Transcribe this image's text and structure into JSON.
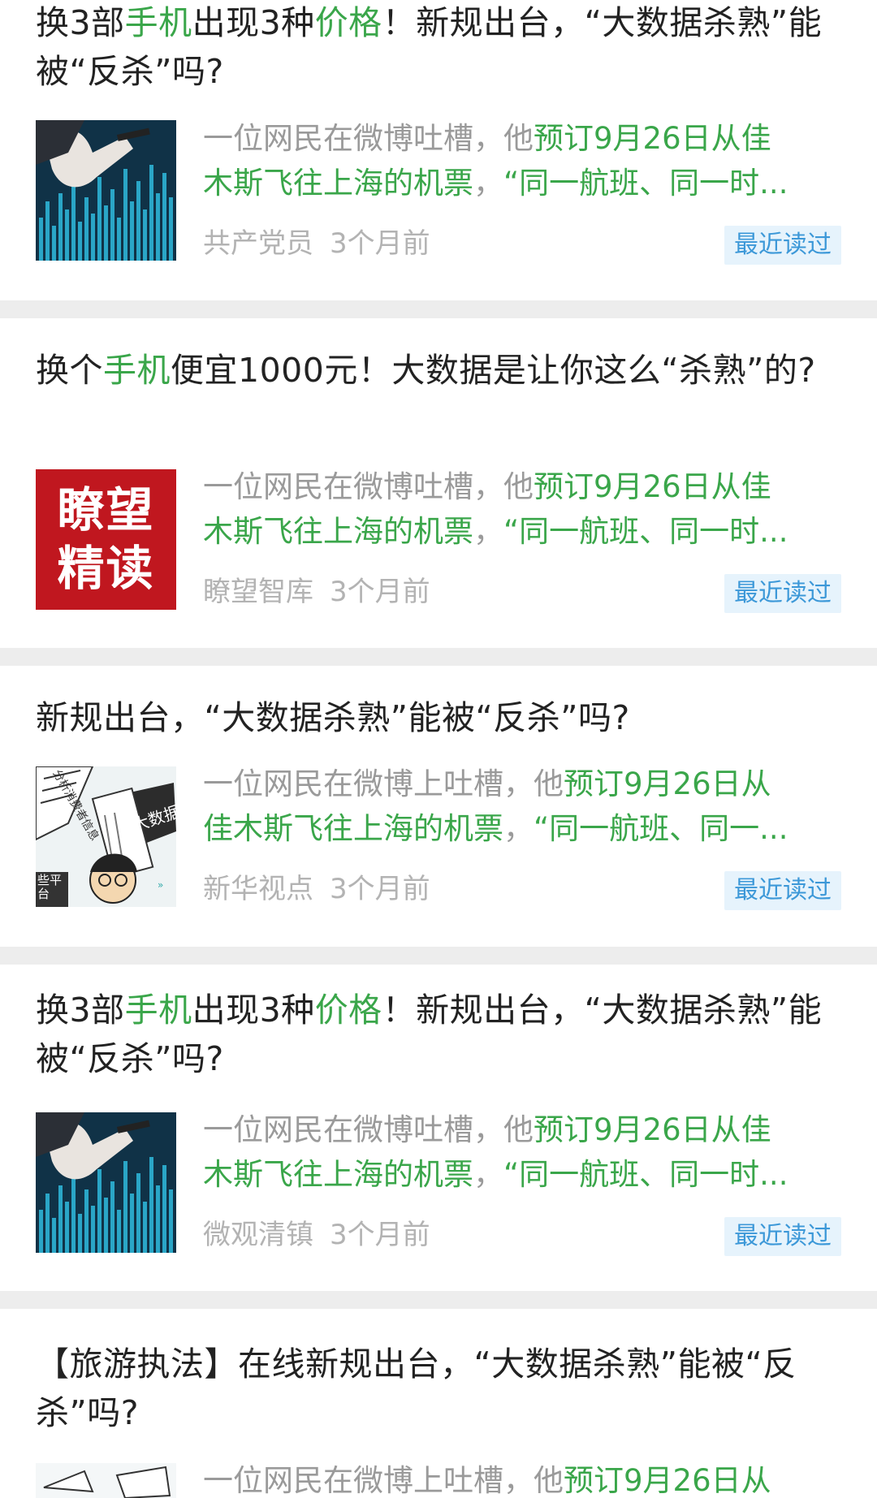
{
  "feed": {
    "cards": [
      {
        "title_parts": [
          "换3部",
          "手机",
          "出现3种",
          "价格",
          "！新规出台，“大数据杀熟”能被“反杀”吗?"
        ],
        "summary_line1_gray": "一位网民在微博吐槽，他",
        "summary_line1_green": "预订9月26日从佳",
        "summary_line2_green": "木斯飞往上海的机票",
        "summary_line2_gray": "，",
        "summary_line2_green2": "“同一航班、同一时...",
        "source": "共产党员",
        "time": "3个月前",
        "badge": "最近读过"
      },
      {
        "title_parts": [
          "换个",
          "手机",
          "便宜1000元！大数据是让你这么“杀熟”的?"
        ],
        "thumb_text": "瞭望精读",
        "summary_line1_gray": "一位网民在微博吐槽，他",
        "summary_line1_green": "预订9月26日从佳",
        "summary_line2_green": "木斯飞往上海的机票",
        "summary_line2_gray": "，",
        "summary_line2_green2": "“同一航班、同一时...",
        "source": "瞭望智库",
        "time": "3个月前",
        "badge": "最近读过"
      },
      {
        "title_parts": [
          "新规出台，“大数据杀熟”能被“反杀”吗?"
        ],
        "thumb_labels": [
          "分析消费者信息",
          "大数据",
          "些平台"
        ],
        "summary_line1_gray": "一位网民在微博上吐槽，他",
        "summary_line1_green": "预订9月26日从",
        "summary_line2_green": "佳木斯飞往上海的机票",
        "summary_line2_gray": "，",
        "summary_line2_green2": "“同一航班、同一...",
        "source": "新华视点",
        "time": "3个月前",
        "badge": "最近读过"
      },
      {
        "title_parts": [
          "换3部",
          "手机",
          "出现3种",
          "价格",
          "！新规出台，“大数据杀熟”能被“反杀”吗?"
        ],
        "summary_line1_gray": "一位网民在微博吐槽，他",
        "summary_line1_green": "预订9月26日从佳",
        "summary_line2_green": "木斯飞往上海的机票",
        "summary_line2_gray": "，",
        "summary_line2_green2": "“同一航班、同一时...",
        "source": "微观清镇",
        "time": "3个月前",
        "badge": "最近读过"
      },
      {
        "title_parts": [
          "【旅游执法】在线新规出台，“大数据杀熟”能被“反杀”吗?"
        ],
        "summary_line1_gray": "一位网民在微博上吐槽，他",
        "summary_line1_green": "预订9月26日从"
      }
    ]
  }
}
